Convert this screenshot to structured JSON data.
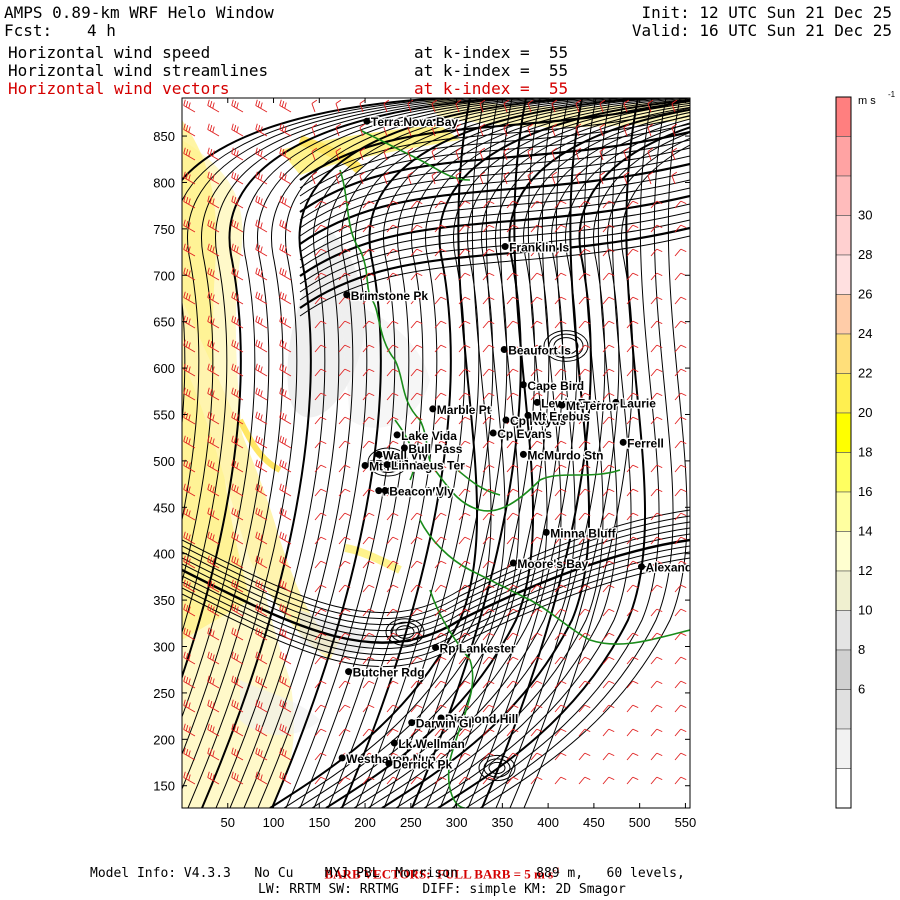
{
  "header": {
    "model_title": "AMPS 0.89-km WRF Helo Window",
    "fcst_label": "Fcst:",
    "fcst_value": "4 h",
    "init": "Init: 12 UTC Sun 21 Dec 25",
    "valid": "Valid: 16 UTC Sun 21 Dec 25",
    "fields": [
      {
        "name": "Horizontal wind speed",
        "level": "at k-index =  55",
        "color": "#000000"
      },
      {
        "name": "Horizontal wind streamlines",
        "level": "at k-index =  55",
        "color": "#000000"
      },
      {
        "name": "Horizontal wind vectors",
        "level": "at k-index =  55",
        "color": "#d40000"
      }
    ]
  },
  "map": {
    "x_ticks": [
      "50",
      "100",
      "150",
      "200",
      "250",
      "300",
      "350",
      "400",
      "450",
      "500",
      "550"
    ],
    "y_ticks": [
      "850",
      "800",
      "750",
      "700",
      "650",
      "600",
      "550",
      "500",
      "450",
      "400",
      "350",
      "300",
      "250",
      "200",
      "150"
    ],
    "locations": [
      {
        "name": "Terra Nova Bay",
        "x": 202,
        "y": 866
      },
      {
        "name": "Franklin Is",
        "x": 353,
        "y": 731
      },
      {
        "name": "Brimstone Pk",
        "x": 180,
        "y": 679
      },
      {
        "name": "Beaufort Is",
        "x": 352,
        "y": 620
      },
      {
        "name": "Cape Bird",
        "x": 373,
        "y": 582
      },
      {
        "name": "Lewis Bay",
        "x": 388,
        "y": 563
      },
      {
        "name": "Laurie",
        "x": 474,
        "y": 563
      },
      {
        "name": "Mt Terror",
        "x": 415,
        "y": 560
      },
      {
        "name": "Marble Pt",
        "x": 274,
        "y": 556
      },
      {
        "name": "Cp Royds",
        "x": 354,
        "y": 544
      },
      {
        "name": "Mt Erebus",
        "x": 378,
        "y": 549
      },
      {
        "name": "Cp Evans",
        "x": 340,
        "y": 530
      },
      {
        "name": "Lake Vida",
        "x": 235,
        "y": 528
      },
      {
        "name": "Ferrell",
        "x": 482,
        "y": 520
      },
      {
        "name": "Wall Vly",
        "x": 215,
        "y": 507
      },
      {
        "name": "Bull Pass",
        "x": 243,
        "y": 514
      },
      {
        "name": "McMurdo Stn",
        "x": 373,
        "y": 507
      },
      {
        "name": "Don Juan",
        "x": 207,
        "y": 497
      },
      {
        "name": "Mt Fleming",
        "x": 200,
        "y": 495
      },
      {
        "name": "Linnaeus Ter",
        "x": 224,
        "y": 496
      },
      {
        "name": "Kennar Vly",
        "x": 215,
        "y": 468
      },
      {
        "name": "Beacon Vly",
        "x": 222,
        "y": 468
      },
      {
        "name": "Minna Bluff",
        "x": 398,
        "y": 423
      },
      {
        "name": "Moore's Bay",
        "x": 362,
        "y": 390
      },
      {
        "name": "Alexander",
        "x": 502,
        "y": 386
      },
      {
        "name": "Rp Lankester",
        "x": 277,
        "y": 299
      },
      {
        "name": "Butcher Rdg",
        "x": 182,
        "y": 273
      },
      {
        "name": "Diamond Hill",
        "x": 283,
        "y": 223
      },
      {
        "name": "Darwin Gl",
        "x": 251,
        "y": 218
      },
      {
        "name": "Lk Wellman",
        "x": 232,
        "y": 196
      },
      {
        "name": "Westhaven Nun",
        "x": 175,
        "y": 180
      },
      {
        "name": "Derrick Pk",
        "x": 226,
        "y": 174
      }
    ]
  },
  "colorbar": {
    "unit": "m s",
    "unit_exp": "-1",
    "labels": [
      "30",
      "28",
      "26",
      "24",
      "22",
      "20",
      "18",
      "16",
      "14",
      "12",
      "10",
      "8",
      "6"
    ],
    "colors": [
      "#ff7f7f",
      "#ffa3a3",
      "#ffbcbc",
      "#ffd0d0",
      "#ffe0e0",
      "#ffcca8",
      "#ffdf7a",
      "#ffef50",
      "#ffff00",
      "#ffff60",
      "#ffffa0",
      "#ffffd0",
      "#f0f0d0",
      "#e4e4e4",
      "#d0d0d0",
      "#e0e0e0",
      "#f2f2f2",
      "#ffffff"
    ]
  },
  "footer": {
    "barb_note": "BARB VECTORS:  FULL BARB = 5 m s",
    "barb_exp": "-1",
    "model_info_1": "Model Info: V4.3.3   No Cu    MYJ PBL  Morrison          889 m,   60 levels,",
    "model_info_2": "LW: RRTM SW: RRTMG   DIFF: simple KM: 2D Smagor"
  }
}
